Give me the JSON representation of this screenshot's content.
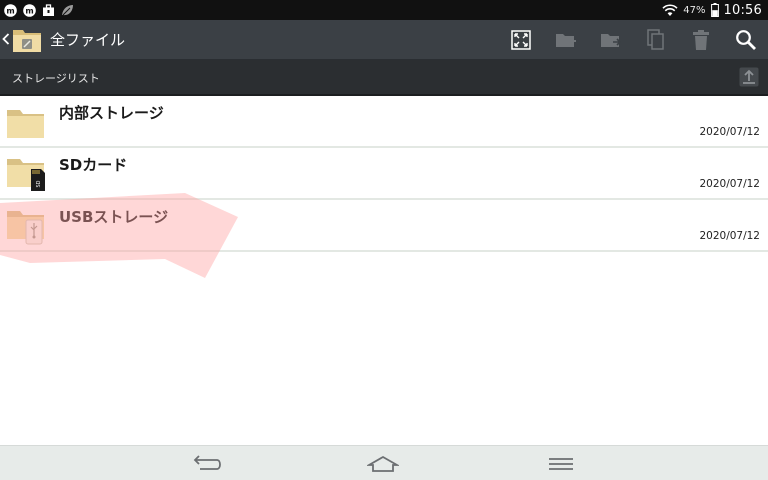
{
  "status_bar": {
    "battery_percent": "47%",
    "time": "10:56",
    "icons": [
      "m-badge-icon",
      "m-badge-icon",
      "briefcase-icon",
      "leaf-icon",
      "wifi-icon",
      "battery-icon"
    ]
  },
  "action_bar": {
    "title": "全ファイル",
    "actions": [
      "fullscreen-icon",
      "new-folder-icon",
      "move-folder-icon",
      "copy-icon",
      "trash-icon",
      "search-icon"
    ]
  },
  "section": {
    "title": "ストレージリスト"
  },
  "items": [
    {
      "name": "内部ストレージ",
      "date": "2020/07/12",
      "icon": "folder-icon"
    },
    {
      "name": "SDカード",
      "date": "2020/07/12",
      "icon": "sd-card-folder-icon"
    },
    {
      "name": "USBストレージ",
      "date": "2020/07/12",
      "icon": "usb-folder-icon"
    }
  ],
  "colors": {
    "action_bar": "#3b4045",
    "section_header": "#2b2e31",
    "folder": "#efd9a0",
    "highlight": "#ff9f9f",
    "nav_bar": "#e7ebe9"
  }
}
